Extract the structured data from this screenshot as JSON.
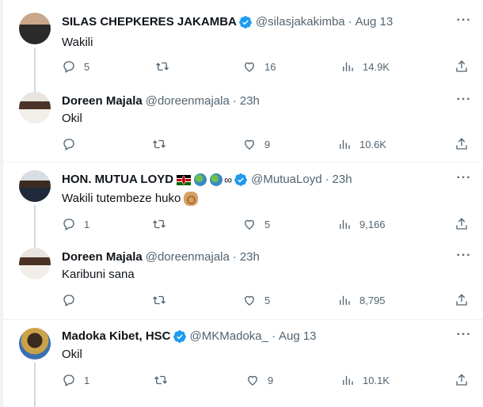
{
  "tweets": [
    {
      "name": "SILAS CHEPKERES JAKAMBA",
      "verified": true,
      "handle": "@silasjakakimba",
      "time": "Aug 13",
      "text": "Wakili",
      "replies": "5",
      "retweets": "",
      "likes": "16",
      "views": "14.9K",
      "avatar": "person-avatar"
    },
    {
      "name": "Doreen Majala",
      "verified": false,
      "handle": "@doreenmajala",
      "time": "23h",
      "text": "Okil",
      "replies": "",
      "retweets": "",
      "likes": "9",
      "views": "10.6K",
      "avatar": "person-avatar"
    },
    {
      "name": "HON. MUTUA LOYD",
      "verified": true,
      "handle": "@MutuaLoyd",
      "time": "23h",
      "text": "Wakili tutembeze huko",
      "replies": "1",
      "retweets": "",
      "likes": "5",
      "views": "9,166",
      "avatar": "person-avatar",
      "name_extras": [
        "kenya-flag-icon",
        "globe-icon",
        "globe-icon",
        "∞"
      ],
      "text_emoji": "ok-hand-icon"
    },
    {
      "name": "Doreen Majala",
      "verified": false,
      "handle": "@doreenmajala",
      "time": "23h",
      "text": "Karibuni sana",
      "replies": "",
      "retweets": "",
      "likes": "5",
      "views": "8,795",
      "avatar": "person-avatar"
    },
    {
      "name": "Madoka Kibet, HSC",
      "verified": true,
      "handle": "@MKMadoka_",
      "time": "Aug 13",
      "text": "Okil",
      "replies": "1",
      "retweets": "",
      "likes": "9",
      "views": "10.1K",
      "avatar": "person-avatar"
    }
  ],
  "separator_dot": "·",
  "more_glyph": "···",
  "colors": {
    "verified": "#1d9bf0",
    "muted": "#536471",
    "text": "#0f1419",
    "border": "#eff3f4"
  },
  "icons": {
    "reply": "reply-icon",
    "retweet": "retweet-icon",
    "like": "heart-icon",
    "views": "views-icon",
    "share": "share-icon",
    "more": "more-icon"
  }
}
